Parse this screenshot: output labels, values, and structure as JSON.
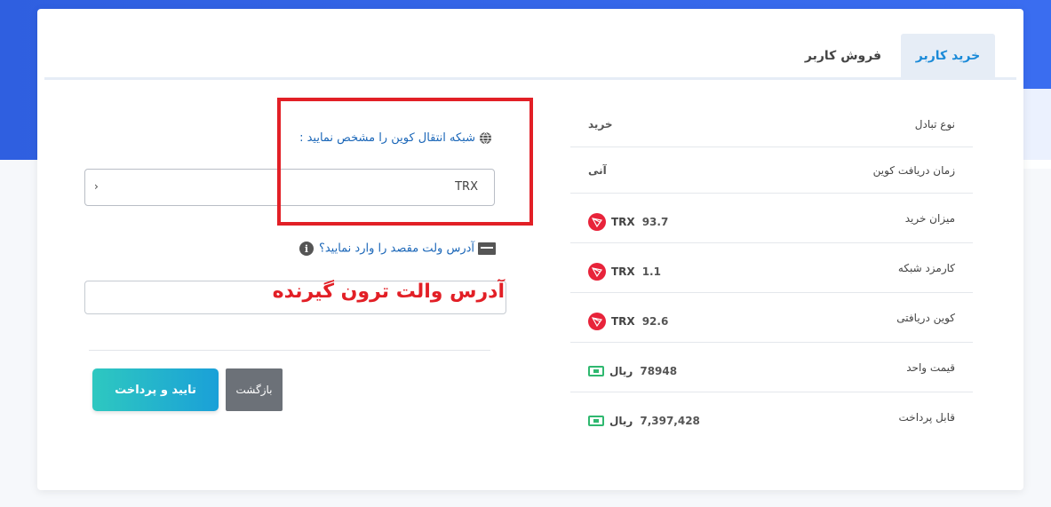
{
  "tabs": {
    "buy": "خرید کاربر",
    "sell": "فروش کاربر"
  },
  "info": {
    "rows": [
      {
        "label": "نوع تبادل",
        "value": "خرید"
      },
      {
        "label": "زمان دریافت کوین",
        "value": "آنی"
      },
      {
        "label": "میزان خرید",
        "value": "93.7",
        "unit": "TRX",
        "icon": "tron-icon"
      },
      {
        "label": "کارمزد شبکه",
        "value": "1.1",
        "unit": "TRX",
        "icon": "tron-icon"
      },
      {
        "label": "کوین دریافتی",
        "value": "92.6",
        "unit": "TRX",
        "icon": "tron-icon"
      },
      {
        "label": "قیمت واحد",
        "value": "78948",
        "unit": "ریال",
        "icon": "money-icon"
      },
      {
        "label": "قابل پرداخت",
        "value": "7,397,428",
        "unit": "ریال",
        "icon": "money-icon"
      }
    ]
  },
  "form": {
    "network_label": "شبکه انتقال کوین را مشخص نمایید :",
    "network_value": "TRX",
    "wallet_label": "آدرس ولت مقصد را وارد نمایید؟",
    "wallet_overlay": "آدرس والت ترون گیرنده",
    "confirm_label": "تایید و پرداخت",
    "back_label": "بازگشت"
  },
  "colors": {
    "accent": "#1a8ad8",
    "highlight": "#e21f26",
    "tron": "#e8233a",
    "rial": "#2fb86f",
    "header_bg": "#2f5fe0"
  }
}
